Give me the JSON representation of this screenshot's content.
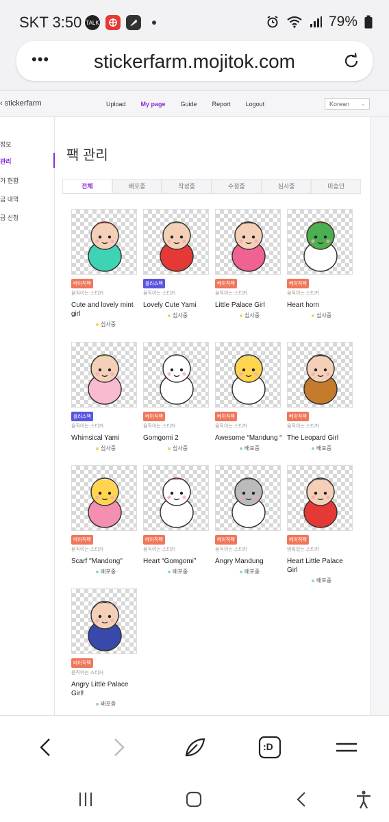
{
  "status_bar": {
    "time": "SKT 3:50",
    "talk_label": "TALK",
    "battery": "79%"
  },
  "browser": {
    "url": "stickerfarm.mojitok.com",
    "menu_label": "•••"
  },
  "site": {
    "brand": "stickerfarm",
    "nav": [
      "Upload",
      "My page",
      "Guide",
      "Report",
      "Logout"
    ],
    "active_nav": "My page",
    "language": "Korean"
  },
  "sidebar": {
    "items": [
      "정보",
      "관리",
      "가 현황",
      "금 내역",
      "급 신청"
    ],
    "active_index": 1
  },
  "page": {
    "title": "팩 관리",
    "tabs": [
      "전체",
      "배포중",
      "작성중",
      "수정중",
      "심사중",
      "미승인"
    ],
    "active_tab": 0
  },
  "packs": [
    {
      "name": "Cute and lovely mint girl",
      "badge": "베이직팩",
      "badge_type": "basic",
      "subtype": "움직이는 스티커",
      "status": "심사중",
      "status_color": "#f5d547",
      "icon": "mint-girl"
    },
    {
      "name": "Lovely Cute Yami",
      "badge": "플러스팩",
      "badge_type": "plus",
      "subtype": "움직이는 스티커",
      "status": "심사중",
      "status_color": "#f5d547",
      "icon": "sorry-tomato"
    },
    {
      "name": "Little Palace Girl",
      "badge": "베이직팩",
      "badge_type": "basic",
      "subtype": "움직이는 스티커",
      "status": "심사중",
      "status_color": "#f5d547",
      "icon": "palace-girl-flowers"
    },
    {
      "name": "Heart horn",
      "badge": "베이직팩",
      "badge_type": "basic",
      "subtype": "움직이는 스티커",
      "status": "심사중",
      "status_color": "#f5d547",
      "icon": "heart-horn-ghost"
    },
    {
      "name": "Whimsical Yami",
      "badge": "플러스팩",
      "badge_type": "plus",
      "subtype": "움직이는 스티커",
      "status": "심사중",
      "status_color": "#f5d547",
      "icon": "whimsical-yami"
    },
    {
      "name": "Gomgomi 2",
      "badge": "베이직팩",
      "badge_type": "basic",
      "subtype": "움직이는 스티커",
      "status": "심사중",
      "status_color": "#f5d547",
      "icon": "wow-bear"
    },
    {
      "name": "Awesome “Mandung “",
      "badge": "베이직팩",
      "badge_type": "basic",
      "subtype": "움직이는 스티커",
      "status": "배포중",
      "status_color": "#8fd8c0",
      "icon": "mandung-awesome"
    },
    {
      "name": "The Leopard Girl",
      "badge": "베이직팩",
      "badge_type": "basic",
      "subtype": "움직이는 스티커",
      "status": "배포중",
      "status_color": "#8fd8c0",
      "icon": "leopard-girl"
    },
    {
      "name": "Scarf \"Mandong\"",
      "badge": "베이직팩",
      "badge_type": "basic",
      "subtype": "움직이는 스티커",
      "status": "배포중",
      "status_color": "#8fd8c0",
      "icon": "scarf-mandong"
    },
    {
      "name": "Heart “Gomgomi”",
      "badge": "베이직팩",
      "badge_type": "basic",
      "subtype": "움직이는 스티커",
      "status": "배포중",
      "status_color": "#8fd8c0",
      "icon": "heart-bear"
    },
    {
      "name": "Angry Mandung",
      "badge": "베이직팩",
      "badge_type": "basic",
      "subtype": "움직이는 스티커",
      "status": "배포중",
      "status_color": "#8fd8c0",
      "icon": "angry-mandung"
    },
    {
      "name": "Heart Little Palace Girl",
      "badge": "베이직팩",
      "badge_type": "basic",
      "subtype": "멈춰있는 스티커",
      "status": "배포중",
      "status_color": "#8fd8c0",
      "icon": "heart-palace-girl"
    },
    {
      "name": "Angry Little Palace Girl!",
      "badge": "베이직팩",
      "badge_type": "basic",
      "subtype": "움직이는 스티커",
      "status": "배포중",
      "status_color": "#8fd8c0",
      "icon": "angry-palace-girl"
    }
  ],
  "browser_toolbar": {
    "icons": [
      "back-icon",
      "forward-icon",
      "leaf-icon",
      "emoji-d-icon",
      "menu-icon"
    ],
    "emoji_text": ":D"
  },
  "system_nav": {
    "icons": [
      "recents-icon",
      "home-icon",
      "back-icon",
      "accessibility-icon"
    ]
  },
  "colors": {
    "accent": "#8b2bd6",
    "basic_badge": "#f0775a",
    "plus_badge": "#5a55e0"
  }
}
